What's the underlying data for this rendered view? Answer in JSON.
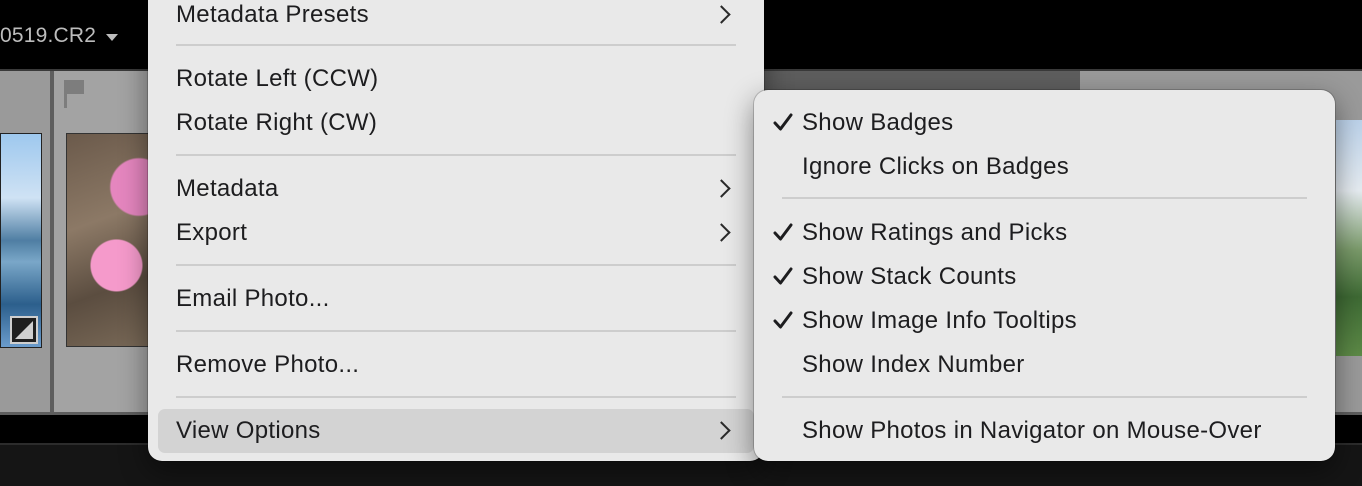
{
  "filmstrip": {
    "filename": "0519.CR2"
  },
  "context_menu": {
    "items": [
      {
        "label": "Metadata Presets",
        "submenu": true
      },
      {
        "label": "Rotate Left (CCW)",
        "submenu": false
      },
      {
        "label": "Rotate Right (CW)",
        "submenu": false
      },
      {
        "label": "Metadata",
        "submenu": true
      },
      {
        "label": "Export",
        "submenu": true
      },
      {
        "label": "Email Photo...",
        "submenu": false
      },
      {
        "label": "Remove Photo...",
        "submenu": false
      },
      {
        "label": "View Options",
        "submenu": true,
        "highlighted": true
      }
    ]
  },
  "view_options_submenu": {
    "items": [
      {
        "label": "Show Badges",
        "checked": true
      },
      {
        "label": "Ignore Clicks on Badges",
        "checked": false
      },
      {
        "label": "Show Ratings and Picks",
        "checked": true
      },
      {
        "label": "Show Stack Counts",
        "checked": true
      },
      {
        "label": "Show Image Info Tooltips",
        "checked": true
      },
      {
        "label": "Show Index Number",
        "checked": false
      },
      {
        "label": "Show Photos in Navigator on Mouse-Over",
        "checked": false
      }
    ]
  },
  "icons": {
    "flag": "flag-icon",
    "edit_badge": "edit-badge-icon",
    "checkmark": "check-icon",
    "submenu_arrow": "chevron-right-icon",
    "dropdown": "chevron-down-icon"
  },
  "colors": {
    "menu_background": "#e9e9e9",
    "menu_highlight": "#d3d3d3",
    "filmstrip_background": "#5e5e5e"
  }
}
